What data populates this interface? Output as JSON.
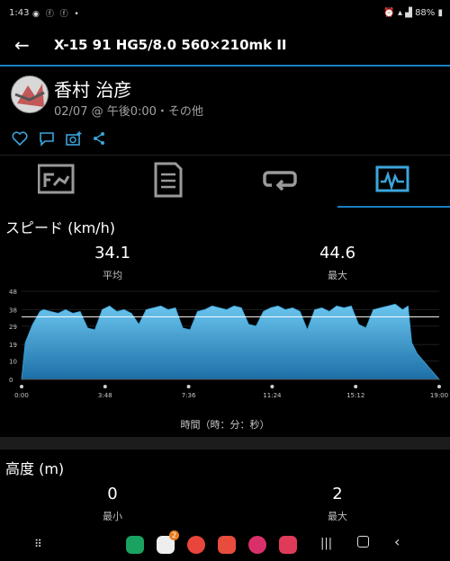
{
  "status": {
    "time": "1:43",
    "battery": "88%"
  },
  "appbar": {
    "title": "X-15 91 HG5/8.0 560×210mk II"
  },
  "user": {
    "name": "香村 治彦",
    "meta": "02/07 @ 午後0:00・その他"
  },
  "tabs": [
    {
      "name": "summary",
      "icon": "summary-icon"
    },
    {
      "name": "laps",
      "icon": "document-icon"
    },
    {
      "name": "route",
      "icon": "loop-icon"
    },
    {
      "name": "charts",
      "icon": "chart-icon",
      "active": true
    }
  ],
  "speed": {
    "title": "スピード (km/h)",
    "avg_value": "34.1",
    "avg_label": "平均",
    "max_value": "44.6",
    "max_label": "最大"
  },
  "chart_data": {
    "type": "area",
    "title": "スピード (km/h)",
    "xlabel": "時間（時：分：秒）",
    "ylabel": "",
    "y_ticks": [
      "0",
      "10",
      "19",
      "29",
      "38",
      "48"
    ],
    "x_ticks": [
      "0:00",
      "3:48",
      "7:36",
      "11:24",
      "15:12",
      "19:00"
    ],
    "ylim": [
      0,
      48
    ],
    "xlim": [
      0,
      1140
    ],
    "avg_line": 34.1,
    "series": [
      {
        "x": [
          0,
          10,
          30,
          50,
          60,
          80,
          100,
          120,
          140,
          160,
          180,
          200,
          220,
          240,
          260,
          280,
          300,
          320,
          340,
          360,
          380,
          400,
          420,
          440,
          460,
          480,
          500,
          520,
          540,
          560,
          580,
          600,
          620,
          640,
          660,
          680,
          700,
          720,
          740,
          760,
          780,
          800,
          820,
          840,
          860,
          880,
          900,
          920,
          940,
          960,
          980,
          1000,
          1020,
          1040,
          1055,
          1065,
          1080,
          1140
        ],
        "y": [
          0,
          20,
          30,
          37,
          38,
          37,
          36,
          38,
          36,
          37,
          28,
          27,
          38,
          40,
          37,
          38,
          36,
          30,
          38,
          39,
          40,
          38,
          39,
          28,
          27,
          37,
          38,
          40,
          39,
          38,
          40,
          39,
          30,
          29,
          37,
          39,
          40,
          38,
          39,
          37,
          27,
          38,
          39,
          37,
          40,
          39,
          40,
          30,
          28,
          38,
          39,
          40,
          41,
          38,
          40,
          20,
          14,
          0
        ]
      }
    ],
    "area_color": "#3aa6dc",
    "line_color": "#ffffff"
  },
  "altitude": {
    "title": "高度 (m)",
    "min_value": "0",
    "min_label": "最小",
    "max_value": "2",
    "max_label": "最大"
  },
  "navbar": {
    "apps_badge": "2"
  }
}
